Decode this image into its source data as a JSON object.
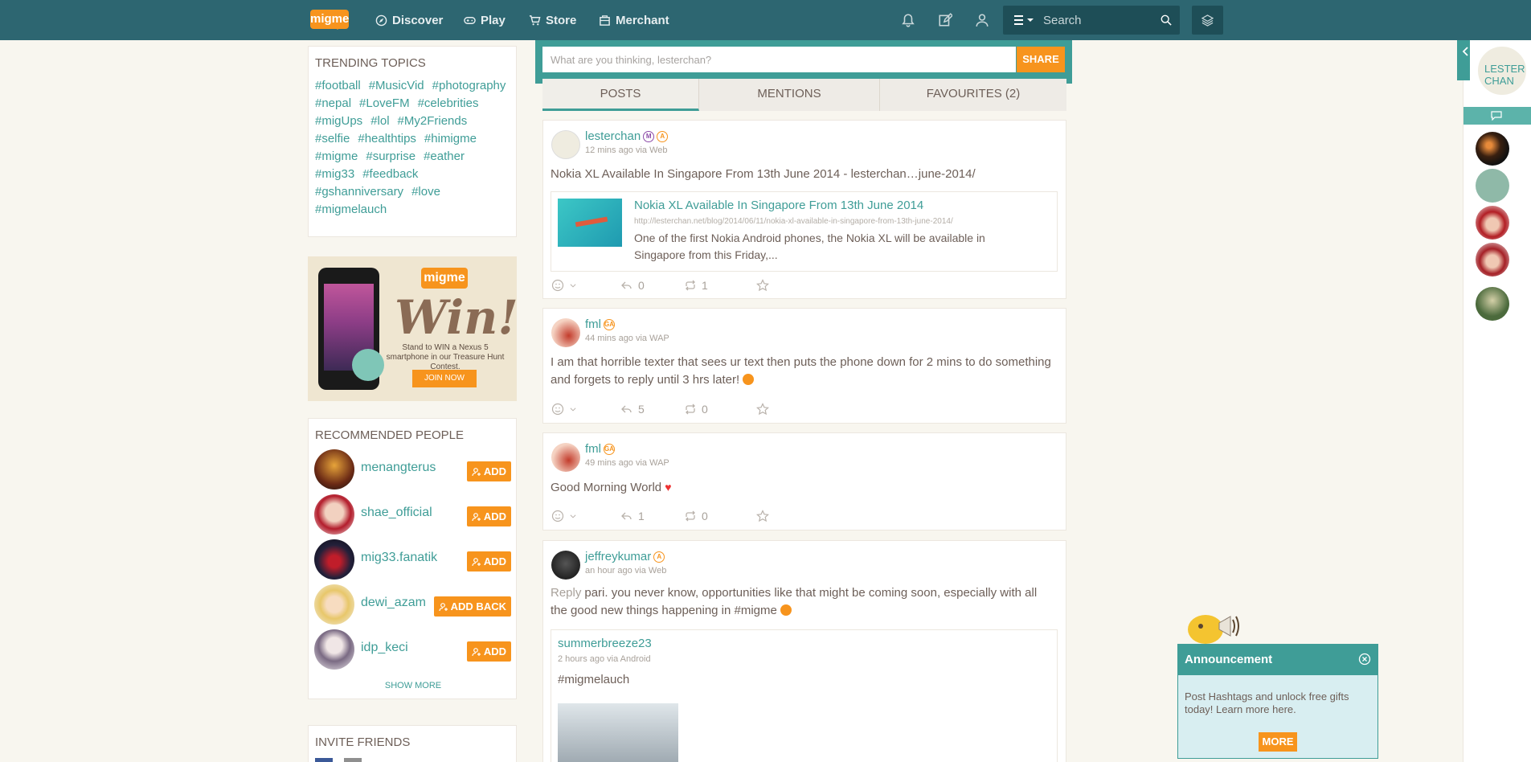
{
  "topbar": {
    "logo": "migme",
    "nav": [
      {
        "label": "Discover",
        "icon": "compass-icon"
      },
      {
        "label": "Play",
        "icon": "gamepad-icon"
      },
      {
        "label": "Store",
        "icon": "cart-icon"
      },
      {
        "label": "Merchant",
        "icon": "merchant-icon"
      }
    ],
    "search_placeholder": "Search"
  },
  "trending": {
    "title": "TRENDING TOPICS",
    "tags": [
      "#football",
      "#MusicVid",
      "#photography",
      "#nepal",
      "#LoveFM",
      "#celebrities",
      "#migUps",
      "#lol",
      "#My2Friends",
      "#selfie",
      "#healthtips",
      "#himigme",
      "#migme",
      "#surprise",
      "#eather",
      "#mig33",
      "#feedback",
      "#gshanniversary",
      "#love",
      "#migmelauch"
    ]
  },
  "promo": {
    "logo": "migme",
    "headline": "Win!",
    "text": "Stand to WIN a Nexus 5 smartphone in our Treasure Hunt Contest.",
    "button": "JOIN NOW"
  },
  "recommended": {
    "title": "RECOMMENDED PEOPLE",
    "people": [
      {
        "name": "menangterus",
        "action": "ADD"
      },
      {
        "name": "shae_official",
        "action": "ADD"
      },
      {
        "name": "mig33.fanatik",
        "action": "ADD"
      },
      {
        "name": "dewi_azam",
        "action": "ADD BACK"
      },
      {
        "name": "idp_keci",
        "action": "ADD"
      }
    ],
    "show_more": "SHOW MORE"
  },
  "invite": {
    "title": "INVITE FRIENDS"
  },
  "composer": {
    "placeholder": "What are you thinking, lesterchan?",
    "share": "SHARE"
  },
  "tabs": [
    "POSTS",
    "MENTIONS",
    "FAVOURITES (2)"
  ],
  "posts": [
    {
      "user": "lesterchan",
      "badges": [
        "M",
        "A"
      ],
      "meta": "12 mins ago via Web",
      "text": "Nokia XL Available In Singapore From 13th June 2014 - lesterchan…june-2014/",
      "link": {
        "title": "Nokia XL Available In Singapore From 13th June 2014",
        "url": "http://lesterchan.net/blog/2014/06/11/nokia-xl-available-in-singapore-from-13th-june-2014/",
        "desc": "One of the first Nokia Android phones, the Nokia XL will be available in Singapore from this Friday,..."
      },
      "replies": "0",
      "reposts": "1"
    },
    {
      "user": "fml",
      "badges": [
        "GA"
      ],
      "meta": "44 mins ago via WAP",
      "text": "I am that horrible texter that sees ur text then puts the phone down for 2 mins to do something and forgets to reply until 3 hrs later!",
      "replies": "5",
      "reposts": "0"
    },
    {
      "user": "fml",
      "badges": [
        "GA"
      ],
      "meta": "49 mins ago via WAP",
      "text": "Good Morning World",
      "replies": "1",
      "reposts": "0"
    },
    {
      "user": "jeffreykumar",
      "badges": [
        "A"
      ],
      "meta": "an hour ago via Web",
      "reply_label": "Reply",
      "text": "pari. you never know, opportunities like that might be coming soon, especially with all the good new things happening in #migme",
      "quote": {
        "user": "summerbreeze23",
        "meta": "2 hours ago via Android",
        "text": "#migmelauch"
      }
    }
  ],
  "rail": {
    "me": "LESTER CHAN"
  },
  "announcement": {
    "title": "Announcement",
    "text": "Post Hashtags and unlock free gifts today! Learn more here.",
    "button": "MORE"
  },
  "colors": {
    "primary": "#2d6671",
    "teal": "#3f9d97",
    "accent": "#f7941d",
    "background": "#f8f6ef"
  }
}
